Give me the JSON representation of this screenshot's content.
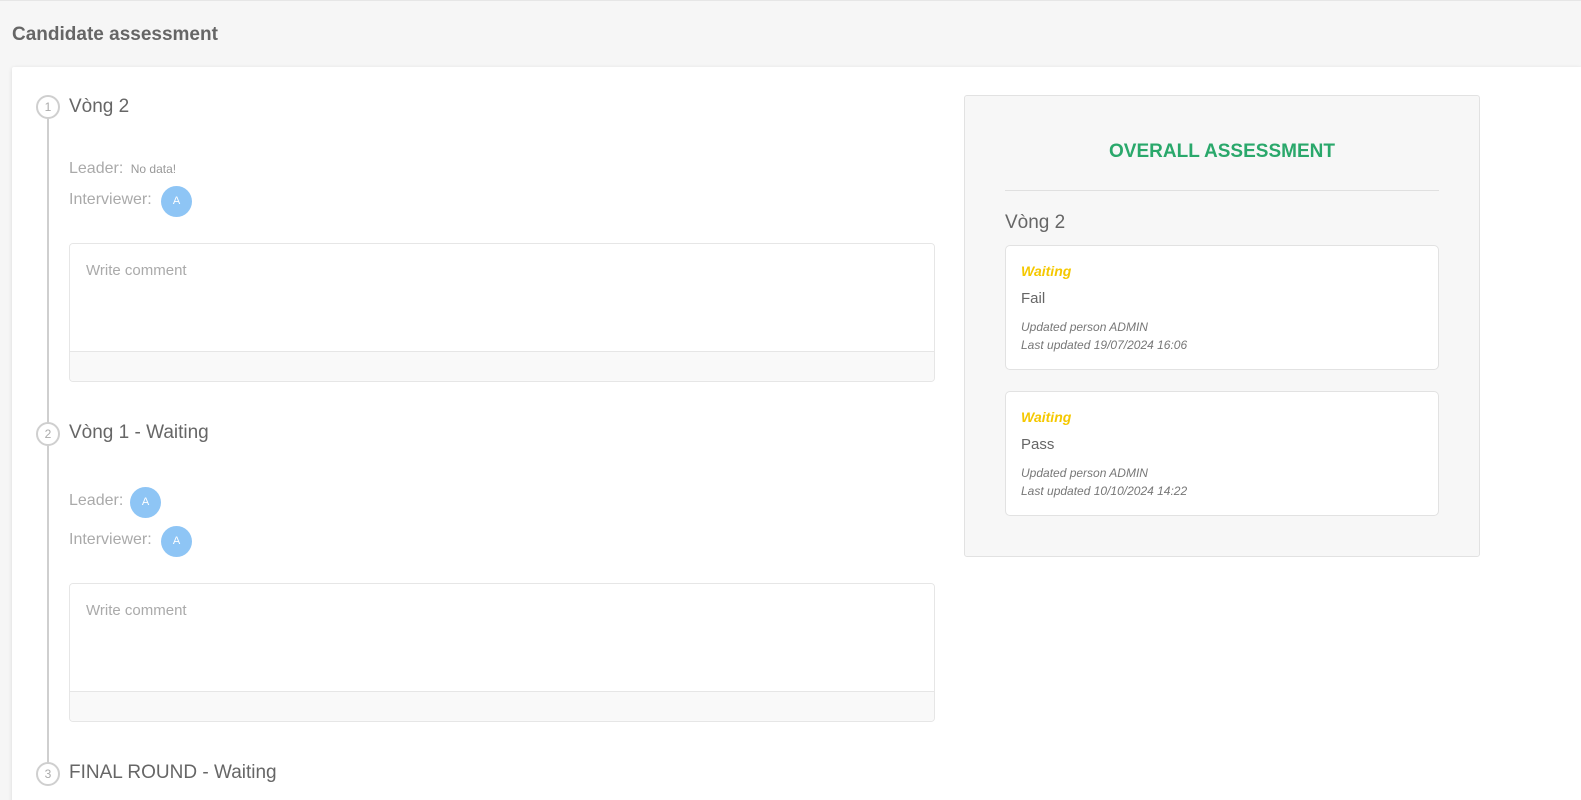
{
  "page": {
    "title": "Candidate assessment"
  },
  "rounds": [
    {
      "step": "1",
      "title": "Vòng 2",
      "leader_label": "Leader:",
      "leader_value": "No data!",
      "interviewer_label": "Interviewer:",
      "interviewer_avatar": "A",
      "comment_placeholder": "Write comment"
    },
    {
      "step": "2",
      "title": "Vòng 1 - Waiting",
      "leader_label": "Leader:",
      "leader_avatar": "A",
      "interviewer_label": "Interviewer:",
      "interviewer_avatar": "A",
      "comment_placeholder": "Write comment"
    },
    {
      "step": "3",
      "title": "FINAL ROUND - Waiting"
    }
  ],
  "summary": {
    "title": "OVERALL ASSESSMENT",
    "round_title": "Vòng 2",
    "assessments": [
      {
        "status": "Waiting",
        "result": "Fail",
        "updated_by": "Updated person ADMIN",
        "updated_at": "Last updated 19/07/2024 16:06"
      },
      {
        "status": "Waiting",
        "result": "Pass",
        "updated_by": "Updated person ADMIN",
        "updated_at": "Last updated 10/10/2024 14:22"
      }
    ]
  },
  "colors": {
    "accent_green": "#2aa86b",
    "status_yellow": "#f5c800",
    "avatar_blue": "#8ec5f5"
  }
}
